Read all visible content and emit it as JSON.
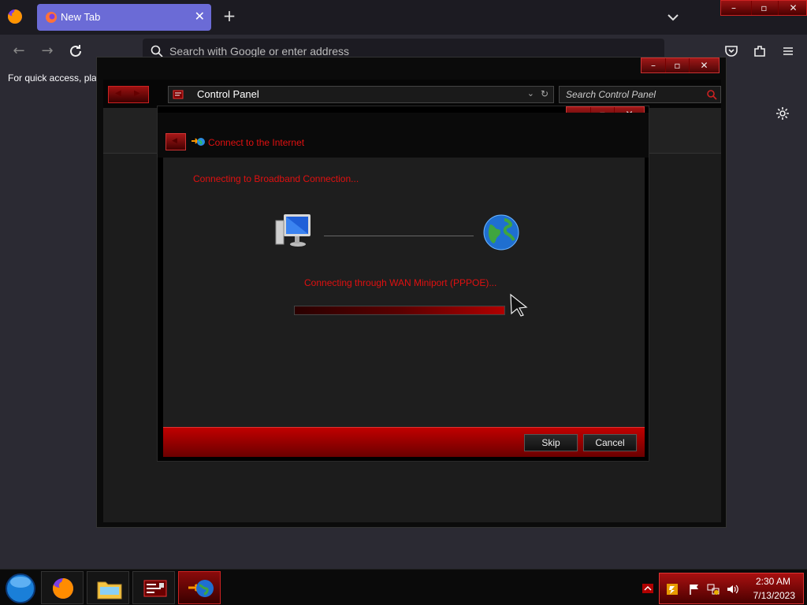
{
  "browser": {
    "tab_title": "New Tab",
    "tab_close": "✕",
    "new_tab": "+",
    "search_placeholder": "Search with Google or enter address",
    "bookmarks_hint": "For quick access, plac",
    "icons": [
      "firefox-icon",
      "search-icon",
      "pocket-icon",
      "extensions-icon",
      "menu-icon",
      "gear-icon",
      "back-icon",
      "forward-icon",
      "reload-icon"
    ]
  },
  "control_panel": {
    "address": "Control Panel",
    "search_placeholder": "Search Control Panel"
  },
  "dialog": {
    "title": "Connect to the Internet",
    "status": "Connecting to Broadband Connection...",
    "detail": "Connecting through WAN Miniport (PPPOE)...",
    "progress": 1.0,
    "buttons": {
      "skip": "Skip",
      "cancel": "Cancel"
    }
  },
  "taskbar": {
    "items": [
      "firefox",
      "explorer",
      "control-panel",
      "connect-to-internet"
    ],
    "active_item": "connect-to-internet",
    "time": "2:30 AM",
    "date": "7/13/2023"
  },
  "colors": {
    "accent": "#c00000",
    "dialog_text": "#e01010",
    "tab_active": "#6b6bd6"
  }
}
